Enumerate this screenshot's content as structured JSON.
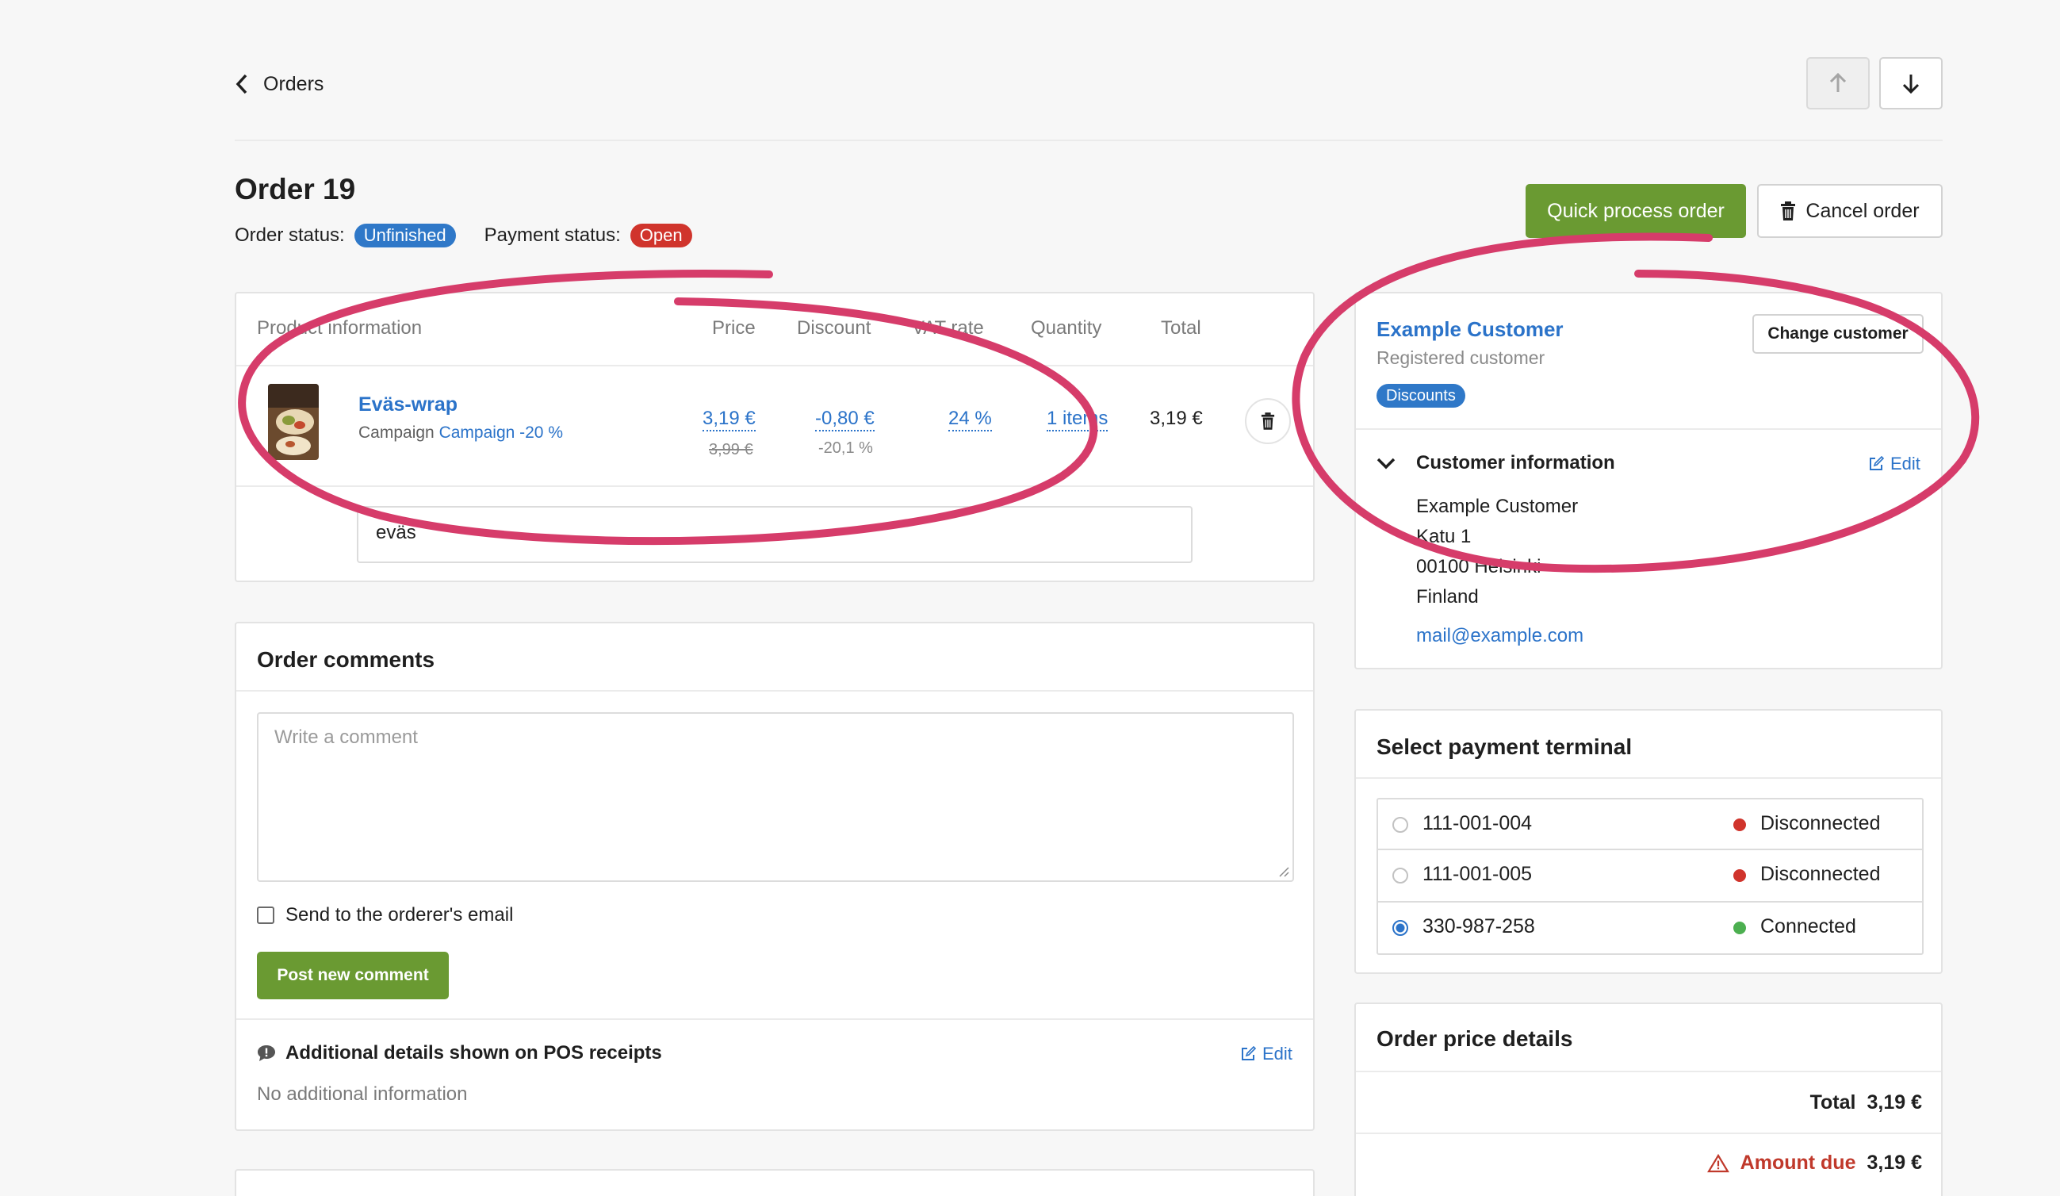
{
  "nav": {
    "back_label": "Orders"
  },
  "order": {
    "title": "Order 19",
    "status_label": "Order status:",
    "status_value": "Unfinished",
    "payment_label": "Payment status:",
    "payment_value": "Open"
  },
  "actions": {
    "quick_process": "Quick process order",
    "cancel": "Cancel order"
  },
  "table": {
    "headers": [
      "Product information",
      "Price",
      "Discount",
      "VAT rate",
      "Quantity",
      "Total"
    ],
    "row": {
      "name": "Eväs-wrap",
      "campaign_label": "Campaign",
      "campaign_link": "Campaign -20 %",
      "price": "3,19 €",
      "price_original": "3,99 €",
      "discount": "-0,80 €",
      "discount_pct": "-20,1 %",
      "vat": "24 %",
      "quantity": "1 items",
      "total": "3,19 €"
    },
    "note_value": "eväs"
  },
  "comments": {
    "title": "Order comments",
    "placeholder": "Write a comment",
    "send_email_label": "Send to the orderer's email",
    "post_button": "Post new comment",
    "additional_title": "Additional details shown on POS receipts",
    "edit_label": "Edit",
    "additional_value": "No additional information"
  },
  "customer": {
    "name": "Example Customer",
    "type": "Registered customer",
    "change_button": "Change customer",
    "discounts_badge": "Discounts",
    "info_title": "Customer information",
    "edit_label": "Edit",
    "address": [
      "Example Customer",
      "Katu 1",
      "00100 Helsinki",
      "Finland"
    ],
    "email": "mail@example.com"
  },
  "terminal": {
    "title": "Select payment terminal",
    "items": [
      {
        "id": "111-001-004",
        "status": "Disconnected",
        "selected": false
      },
      {
        "id": "111-001-005",
        "status": "Disconnected",
        "selected": false
      },
      {
        "id": "330-987-258",
        "status": "Connected",
        "selected": true
      }
    ]
  },
  "price_details": {
    "title": "Order price details",
    "total_label": "Total",
    "total_value": "3,19 €",
    "due_label": "Amount due",
    "due_value": "3,19 €"
  },
  "colors": {
    "brand_green": "#6a9a32",
    "link_blue": "#2b73c9",
    "badge_blue": "#2f78c8",
    "badge_red": "#d0342c",
    "annotation_pink": "#d63c6a",
    "status_connected": "#4caf50",
    "status_disconnected": "#d0342c"
  }
}
